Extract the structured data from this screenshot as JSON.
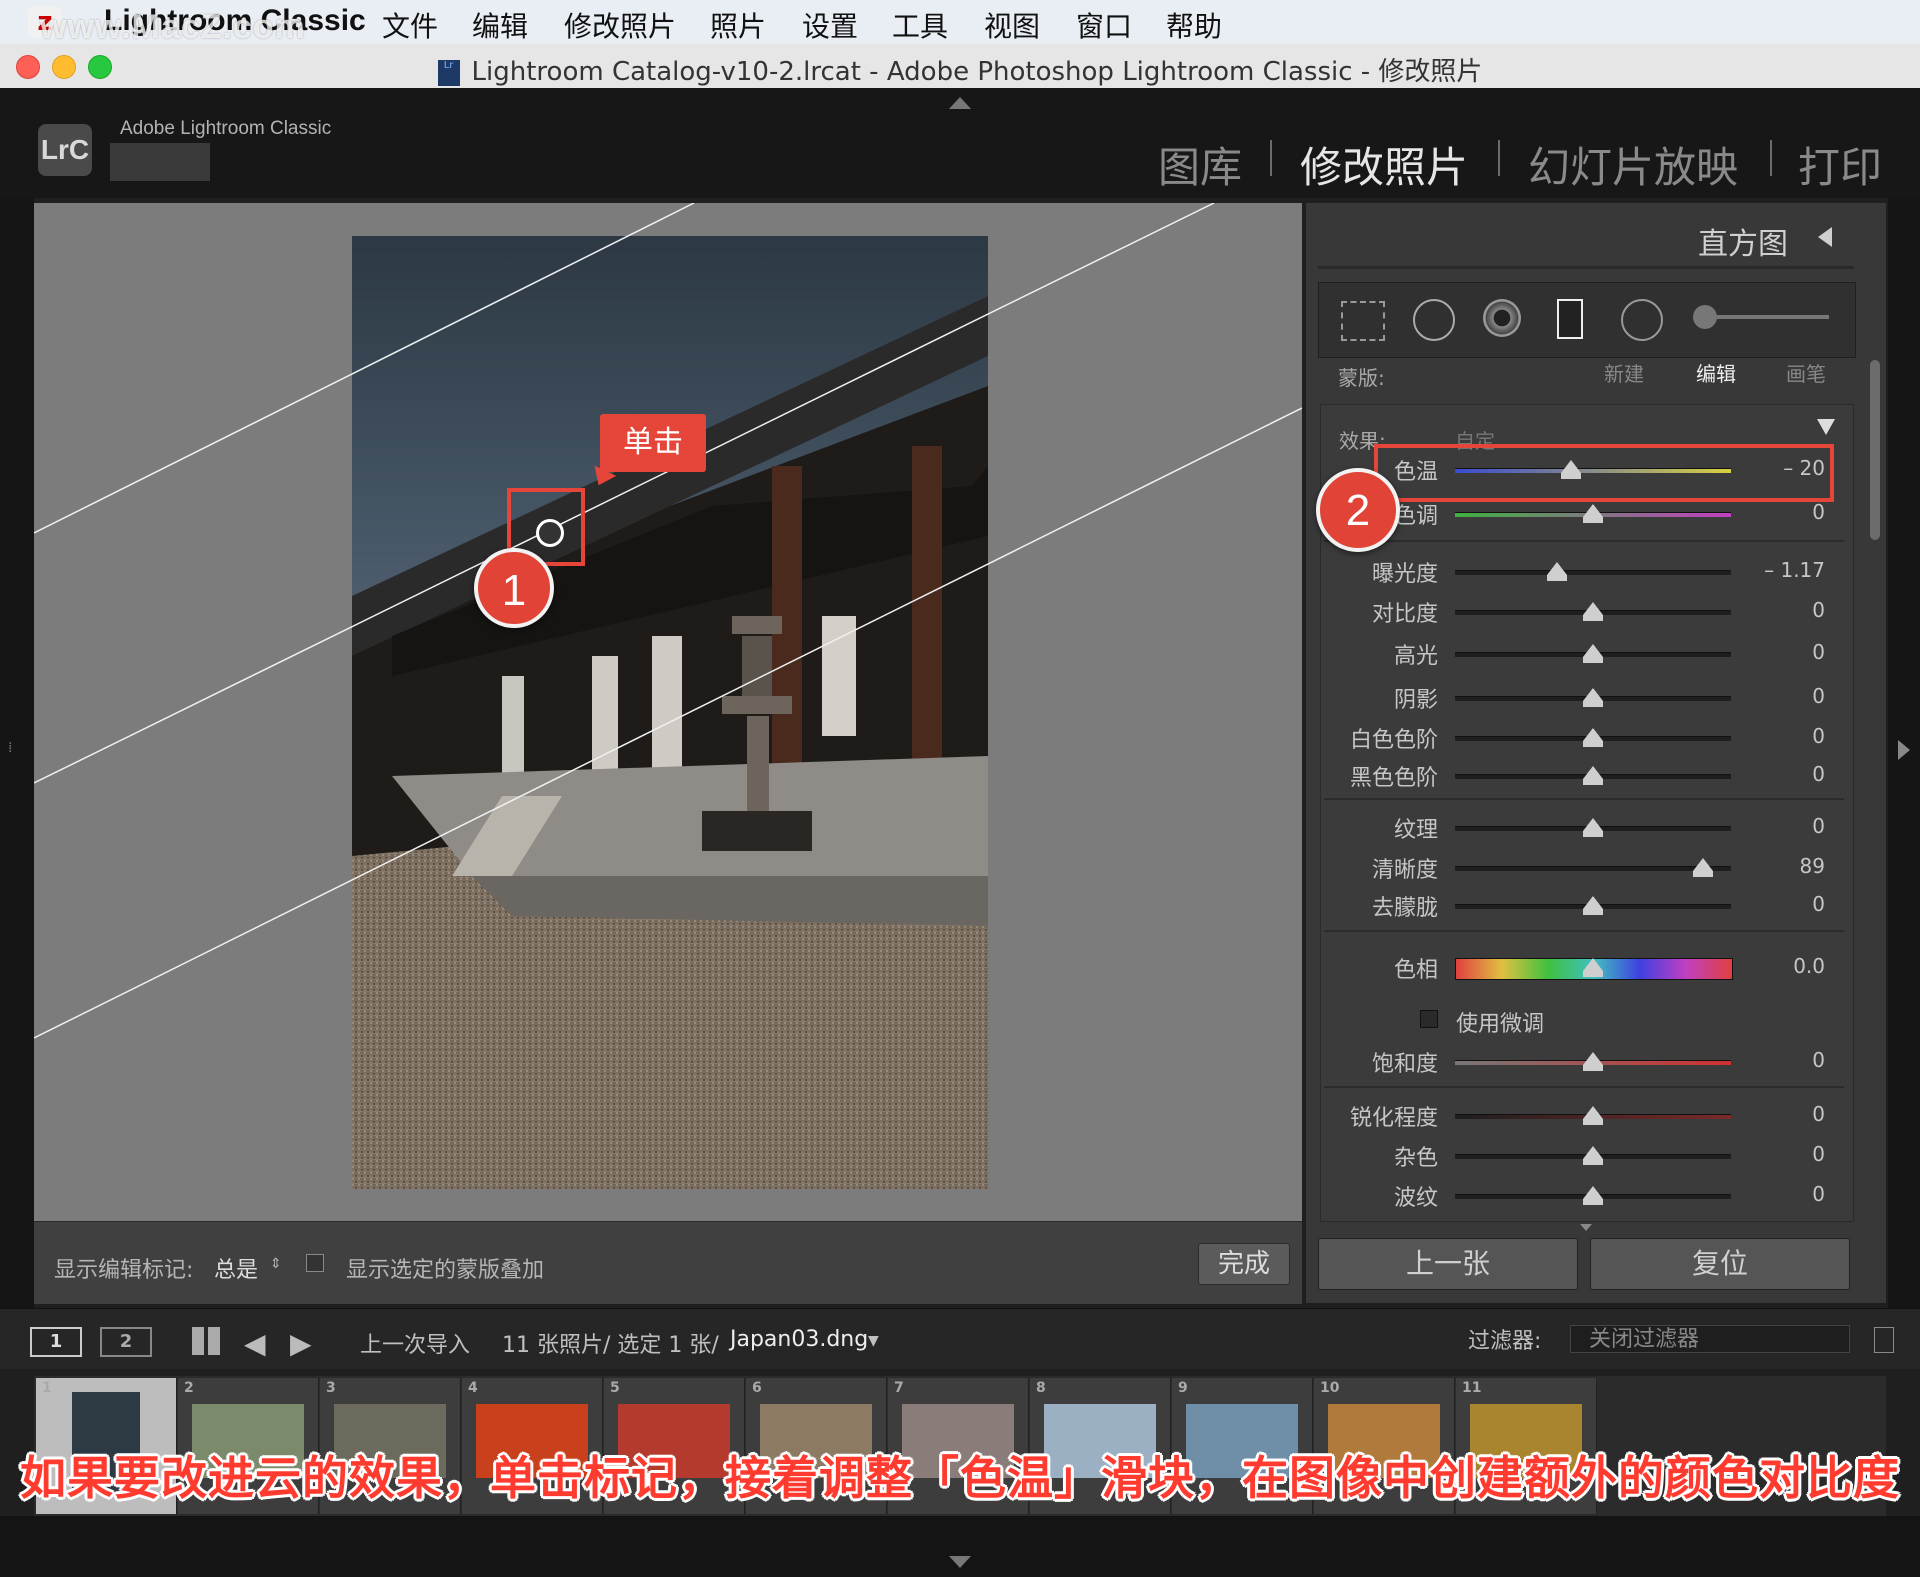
{
  "menubar": {
    "watermark": "www.MacZ.com",
    "app_name": "Lightroom Classic",
    "items": [
      "文件",
      "编辑",
      "修改照片",
      "照片",
      "设置",
      "工具",
      "视图",
      "窗口",
      "帮助"
    ]
  },
  "window": {
    "title": "Lightroom Catalog-v10-2.lrcat - Adobe Photoshop Lightroom Classic - 修改照片"
  },
  "header": {
    "logo": "LrC",
    "app_label": "Adobe Lightroom Classic",
    "modules": [
      "图库",
      "修改照片",
      "幻灯片放映",
      "打印"
    ],
    "active_module": "修改照片"
  },
  "right_panel": {
    "histogram_title": "直方图",
    "mask": {
      "label": "蒙版:",
      "new": "新建",
      "edit": "编辑",
      "brush": "画笔"
    },
    "effect": {
      "label": "效果:",
      "value": "自定"
    },
    "sliders": [
      {
        "label": "色温",
        "value": "– 20",
        "pos": 0.42,
        "track": "temp"
      },
      {
        "label": "色调",
        "value": "0",
        "pos": 0.5,
        "track": "tint"
      },
      {
        "label": "曝光度",
        "value": "– 1.17",
        "pos": 0.37,
        "track": "plain"
      },
      {
        "label": "对比度",
        "value": "0",
        "pos": 0.5,
        "track": "plain"
      },
      {
        "label": "高光",
        "value": "0",
        "pos": 0.5,
        "track": "plain"
      },
      {
        "label": "阴影",
        "value": "0",
        "pos": 0.5,
        "track": "plain"
      },
      {
        "label": "白色色阶",
        "value": "0",
        "pos": 0.5,
        "track": "plain"
      },
      {
        "label": "黑色色阶",
        "value": "0",
        "pos": 0.5,
        "track": "plain"
      },
      {
        "label": "纹理",
        "value": "0",
        "pos": 0.5,
        "track": "plain"
      },
      {
        "label": "清晰度",
        "value": "89",
        "pos": 0.9,
        "track": "plain"
      },
      {
        "label": "去朦胧",
        "value": "0",
        "pos": 0.5,
        "track": "plain"
      },
      {
        "label": "色相",
        "value": "0.0",
        "pos": 0.5,
        "track": "hue"
      },
      {
        "label": "饱和度",
        "value": "0",
        "pos": 0.5,
        "track": "sat"
      },
      {
        "label": "锐化程度",
        "value": "0",
        "pos": 0.5,
        "track": "sharp"
      },
      {
        "label": "杂色",
        "value": "0",
        "pos": 0.5,
        "track": "plain"
      },
      {
        "label": "波纹",
        "value": "0",
        "pos": 0.5,
        "track": "plain"
      }
    ],
    "fine_tune_label": "使用微调",
    "prev_button": "上一张",
    "reset_button": "复位"
  },
  "toolbar": {
    "show_edit_pins_label": "显示编辑标记:",
    "show_edit_pins_value": "总是",
    "show_overlay_label": "显示选定的蒙版叠加",
    "done_button": "完成"
  },
  "filmbar": {
    "view1": "1",
    "view2": "2",
    "source": "上一次导入",
    "count": "11 张照片/ 选定 1 张/",
    "filename": "Japan03.dng",
    "filter_label": "过滤器:",
    "filter_value": "关闭过滤器"
  },
  "filmstrip": {
    "thumbs": [
      {
        "num": "1",
        "color": "#2d3a44"
      },
      {
        "num": "2",
        "color": "#7a8a6a"
      },
      {
        "num": "3",
        "color": "#6b6a5c"
      },
      {
        "num": "4",
        "color": "#c8401c"
      },
      {
        "num": "5",
        "color": "#b33a2c"
      },
      {
        "num": "6",
        "color": "#8d7a62"
      },
      {
        "num": "7",
        "color": "#8a7c78"
      },
      {
        "num": "8",
        "color": "#9cb0c4"
      },
      {
        "num": "9",
        "color": "#6f8ea8"
      },
      {
        "num": "10",
        "color": "#b07a3c"
      },
      {
        "num": "11",
        "color": "#a8852e"
      }
    ]
  },
  "annotations": {
    "tip": "单击",
    "marker1": "1",
    "marker2": "2",
    "caption": "如果要改进云的效果，单击标记，接着调整「色温」滑块，在图像中创建额外的颜色对比度"
  },
  "colors": {
    "accent_red": "#e6453a"
  }
}
